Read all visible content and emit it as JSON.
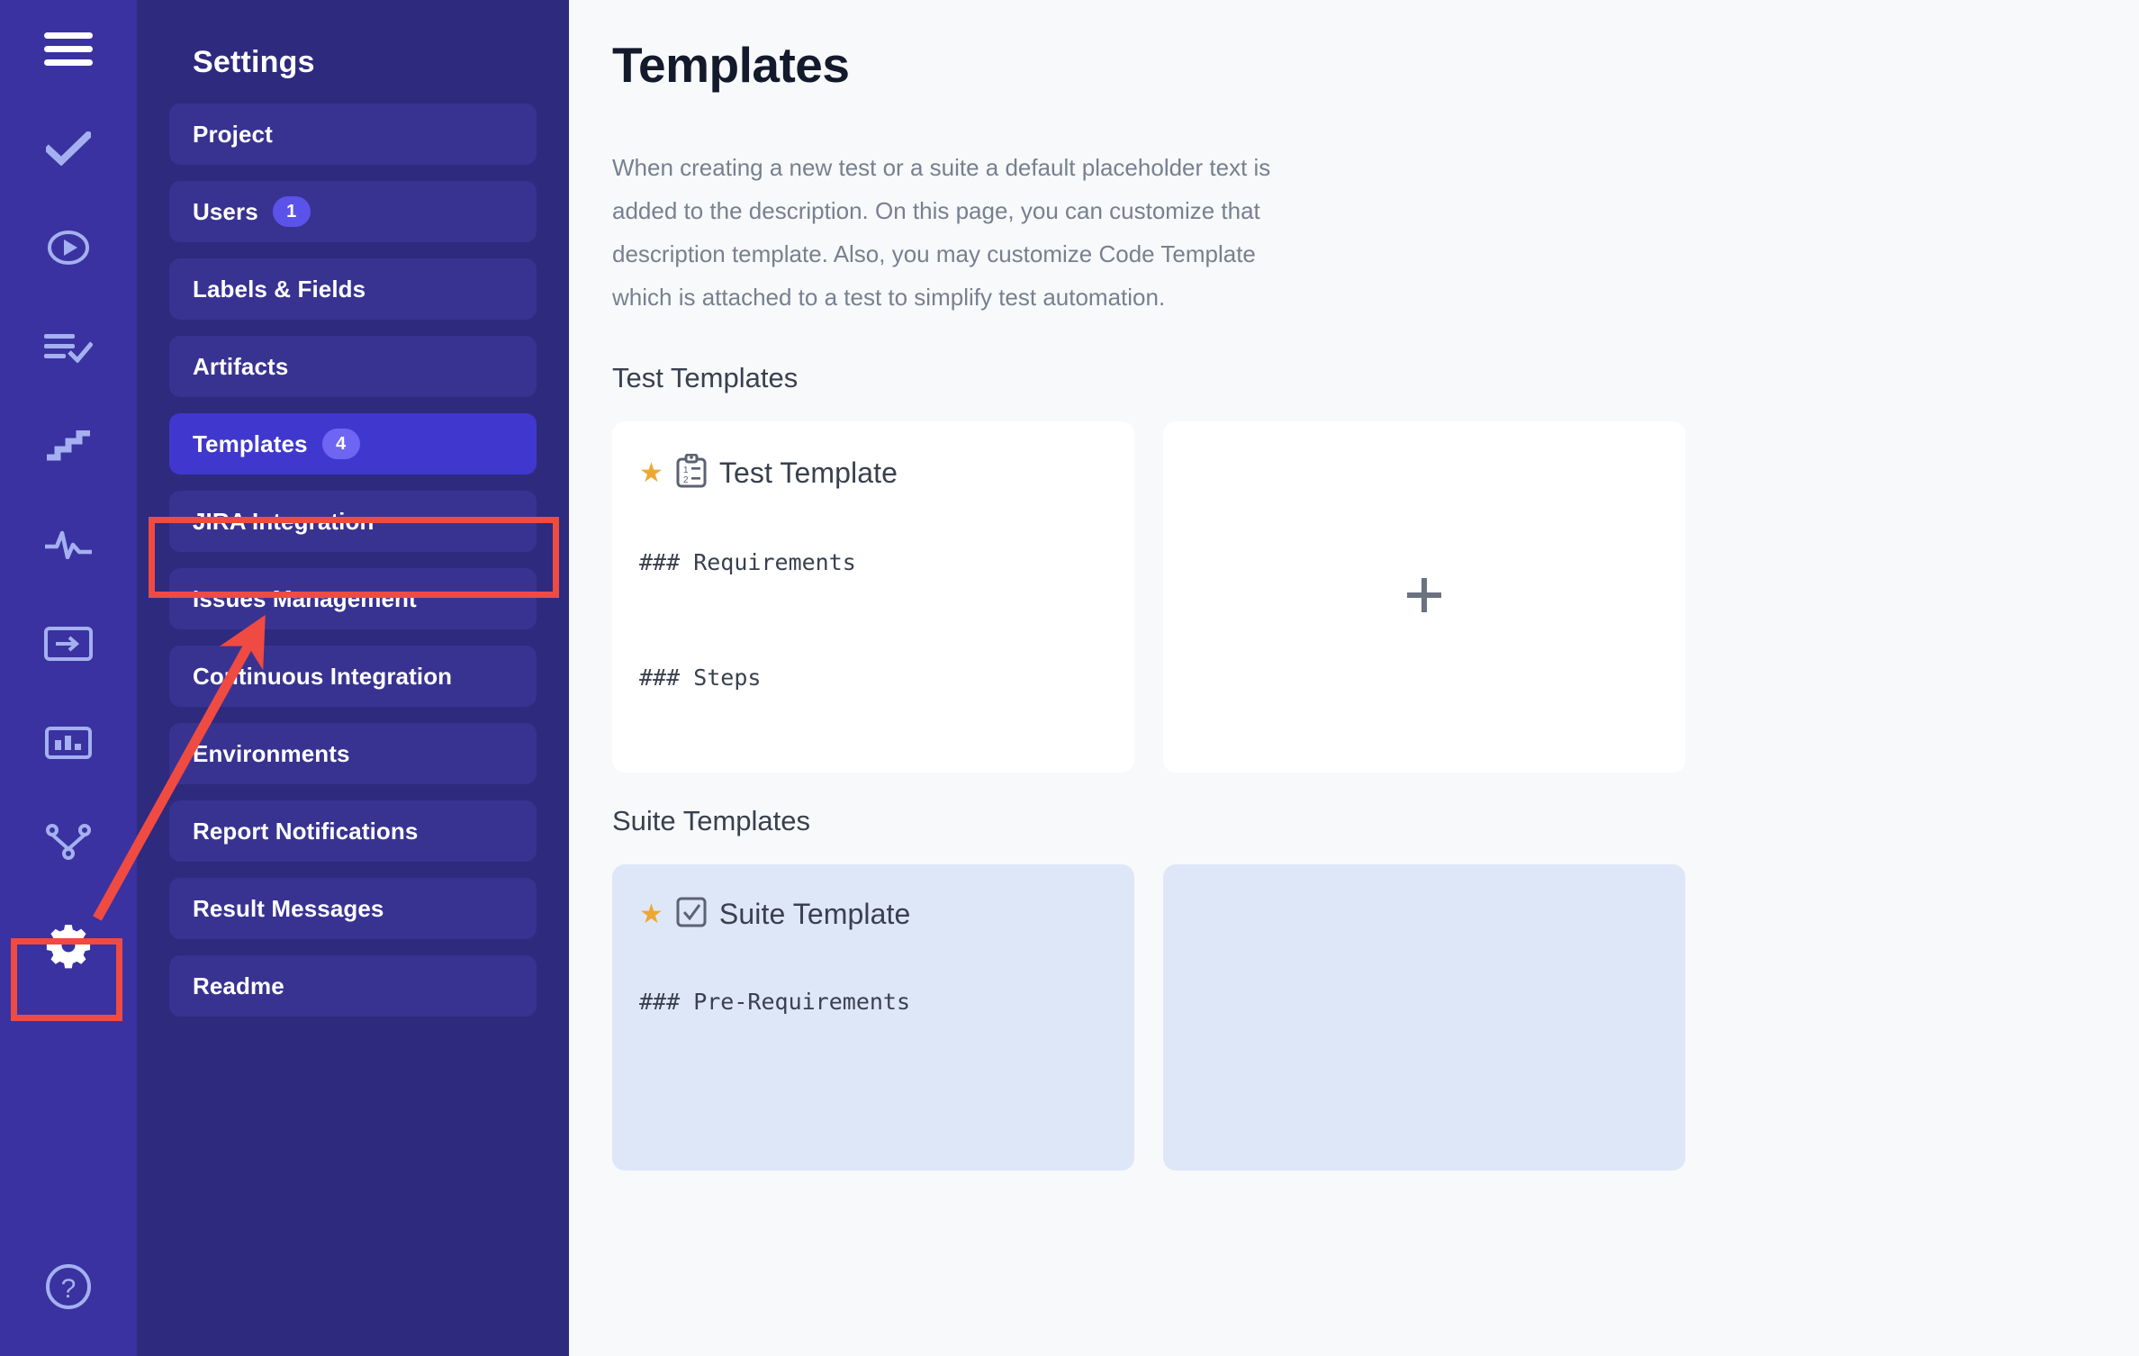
{
  "rail": {
    "items": [
      {
        "name": "menu-icon",
        "label": "Menu"
      },
      {
        "name": "check-icon",
        "label": "Tests"
      },
      {
        "name": "play-circle-icon",
        "label": "Runs"
      },
      {
        "name": "list-check-icon",
        "label": "Results"
      },
      {
        "name": "stairs-icon",
        "label": "Progress"
      },
      {
        "name": "pulse-icon",
        "label": "Activity"
      },
      {
        "name": "import-icon",
        "label": "Import"
      },
      {
        "name": "chart-bar-icon",
        "label": "Reports"
      },
      {
        "name": "branch-icon",
        "label": "Integrations"
      },
      {
        "name": "gear-icon",
        "label": "Settings"
      }
    ],
    "help": {
      "name": "help-circle-icon",
      "label": "Help"
    }
  },
  "sidebar": {
    "title": "Settings",
    "items": [
      {
        "label": "Project",
        "badge": "",
        "active": false
      },
      {
        "label": "Users",
        "badge": "1",
        "active": false
      },
      {
        "label": "Labels & Fields",
        "badge": "",
        "active": false
      },
      {
        "label": "Artifacts",
        "badge": "",
        "active": false
      },
      {
        "label": "Templates",
        "badge": "4",
        "active": true
      },
      {
        "label": "JIRA Integration",
        "badge": "",
        "active": false
      },
      {
        "label": "Issues Management",
        "badge": "",
        "active": false
      },
      {
        "label": "Continuous Integration",
        "badge": "",
        "active": false
      },
      {
        "label": "Environments",
        "badge": "",
        "active": false
      },
      {
        "label": "Report Notifications",
        "badge": "",
        "active": false
      },
      {
        "label": "Result Messages",
        "badge": "",
        "active": false
      },
      {
        "label": "Readme",
        "badge": "",
        "active": false
      }
    ]
  },
  "main": {
    "title": "Templates",
    "description": "When creating a new test or a suite a default placeholder text is added to the description. On this page, you can customize that description template. Also, you may customize Code Template which is attached to a test to simplify test automation.",
    "test_section": {
      "title": "Test Templates",
      "card": {
        "star": "★",
        "icon": "clipboard-list-icon",
        "title": "Test Template",
        "body": "### Requirements\n\n### Steps"
      },
      "add_label": "+"
    },
    "suite_section": {
      "title": "Suite Templates",
      "card": {
        "star": "★",
        "icon": "checkbox-icon",
        "title": "Suite Template",
        "body": "### Pre-Requirements"
      }
    }
  },
  "annotations": {
    "highlight_color": "#EF4B42",
    "gear_box_label": "settings-gear-highlight",
    "templates_box_label": "templates-item-highlight",
    "arrow_label": "pointer-arrow"
  },
  "colors": {
    "rail_bg": "#3A32A0",
    "sidebar_bg": "#2E2A7E",
    "nav_item_bg": "#383391",
    "nav_item_active_bg": "#4038CE",
    "badge_bg": "#5B52EA",
    "content_bg": "#F7F9FB",
    "card_bg": "#FFFFFF",
    "suite_card_bg": "#DEE7F8",
    "star": "#EFA733",
    "accent_red": "#EF4B42"
  }
}
